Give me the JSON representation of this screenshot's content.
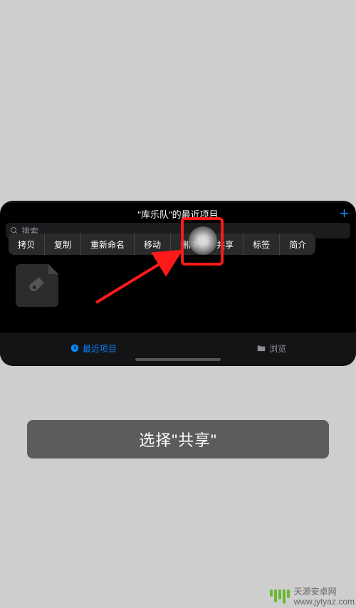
{
  "panel": {
    "title": "\"库乐队\"的最近项目",
    "plus": "+"
  },
  "search": {
    "placeholder": "搜索"
  },
  "menu": {
    "items": [
      "拷贝",
      "复制",
      "重新命名",
      "移动",
      "删除",
      "共享",
      "标签",
      "简介"
    ]
  },
  "tabs": {
    "recent": "最近项目",
    "browse": "浏览"
  },
  "caption": "选择\"共享\"",
  "watermark": {
    "line1": "天源安卓网",
    "line2": "www.jytyaz.com"
  }
}
